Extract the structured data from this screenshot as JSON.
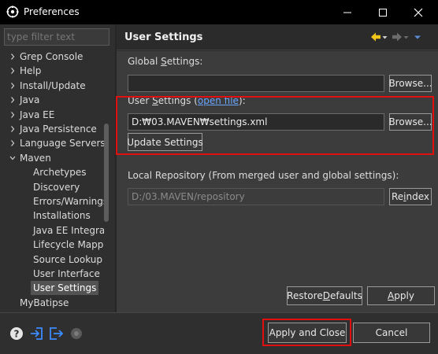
{
  "window": {
    "title": "Preferences",
    "minimize_icon": "minimize-icon",
    "maximize_icon": "maximize-icon",
    "close_icon": "close-icon"
  },
  "filter": {
    "placeholder": "type filter text",
    "value": ""
  },
  "tree": {
    "items": [
      {
        "label": "Grep Console",
        "level": 0,
        "expandable": true,
        "expanded": false
      },
      {
        "label": "Help",
        "level": 0,
        "expandable": true,
        "expanded": false
      },
      {
        "label": "Install/Update",
        "level": 0,
        "expandable": true,
        "expanded": false
      },
      {
        "label": "Java",
        "level": 0,
        "expandable": true,
        "expanded": false
      },
      {
        "label": "Java EE",
        "level": 0,
        "expandable": true,
        "expanded": false
      },
      {
        "label": "Java Persistence",
        "level": 0,
        "expandable": true,
        "expanded": false
      },
      {
        "label": "Language Servers",
        "level": 0,
        "expandable": true,
        "expanded": false
      },
      {
        "label": "Maven",
        "level": 0,
        "expandable": true,
        "expanded": true
      },
      {
        "label": "Archetypes",
        "level": 1,
        "expandable": false
      },
      {
        "label": "Discovery",
        "level": 1,
        "expandable": false
      },
      {
        "label": "Errors/Warnings",
        "level": 1,
        "expandable": false
      },
      {
        "label": "Installations",
        "level": 1,
        "expandable": false
      },
      {
        "label": "Java EE Integrati",
        "level": 1,
        "expandable": false
      },
      {
        "label": "Lifecycle Mappin",
        "level": 1,
        "expandable": false
      },
      {
        "label": "Source Lookup",
        "level": 1,
        "expandable": false
      },
      {
        "label": "User Interface",
        "level": 1,
        "expandable": false
      },
      {
        "label": "User Settings",
        "level": 1,
        "expandable": false,
        "selected": true
      },
      {
        "label": "MyBatipse",
        "level": 0,
        "expandable": false
      }
    ]
  },
  "page": {
    "title": "User Settings",
    "nav_icons": [
      "back-arrow-icon",
      "dropdown-icon",
      "forward-arrow-icon",
      "dropdown-icon",
      "view-menu-icon"
    ],
    "global_settings": {
      "label_pre": "Global ",
      "label_mn": "S",
      "label_post": "ettings:",
      "value": "",
      "browse_label": "Browse..."
    },
    "user_settings": {
      "label_pre": "User ",
      "label_mn": "S",
      "label_post": "ettings (",
      "link": "open file",
      "label_end": "):",
      "value": "D:₩03.MAVEN₩settings.xml",
      "browse_label": "Browse..."
    },
    "update_settings_label": "Update Settings",
    "local_repo": {
      "label": "Local Repository (From merged user and global settings):",
      "value": "D:/03.MAVEN/repository",
      "reindex_pre": "Re",
      "reindex_mn": "i",
      "reindex_post": "ndex"
    },
    "restore_defaults": {
      "pre": "Restore ",
      "mn": "D",
      "post": "efaults"
    },
    "apply": {
      "pre": "",
      "mn": "A",
      "post": "pply"
    }
  },
  "footer": {
    "icons": [
      "help-icon",
      "import-icon",
      "export-icon",
      "record-icon"
    ],
    "apply_close_label": "Apply and Close",
    "cancel_label": "Cancel"
  },
  "colors": {
    "highlight_box": "#e01010",
    "link": "#6aa6ff",
    "nav_back_arrow": "#f0c419"
  }
}
